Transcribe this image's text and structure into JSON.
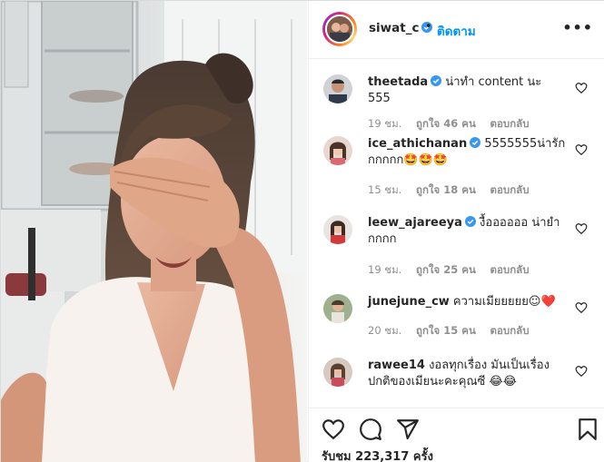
{
  "header": {
    "username": "siwat_c",
    "dot": "•",
    "follow_label": "ติดตาม",
    "more_label": "•••"
  },
  "comments": [
    {
      "username": "theetada",
      "verified": true,
      "text": "น่าทำ content นะ 555",
      "time": "19 ชม.",
      "likes": "ถูกใจ 46 คน",
      "reply": "ตอบกลับ"
    },
    {
      "username": "ice_athichanan",
      "verified": true,
      "text": "5555555น่ารักกกกกก🤩🤩🤩",
      "time": "15 ชม.",
      "likes": "ถูกใจ 18 คน",
      "reply": "ตอบกลับ"
    },
    {
      "username": "leew_ajareeya",
      "verified": true,
      "text": "งื้ออออออ น่ายํากกกก",
      "time": "19 ชม.",
      "likes": "ถูกใจ 25 คน",
      "reply": "ตอบกลับ"
    },
    {
      "username": "junejune_cw",
      "verified": false,
      "text": "ความเมียยยยย☺❤️",
      "time": "20 ชม.",
      "likes": "ถูกใจ 15 คน",
      "reply": "ตอบกลับ"
    },
    {
      "username": "rawee14",
      "verified": false,
      "text": "งอลทุกเรื่อง มันเป็นเรื่องปกติของเมียนะคะคุณซี 😂😂",
      "time": "",
      "likes": "",
      "reply": ""
    }
  ],
  "actions": {
    "views": "รับชม 223,317 ครั้ง"
  },
  "icons": {
    "verified": "verified-badge-icon",
    "heart": "heart-outline-icon",
    "comment": "comment-bubble-icon",
    "share": "paper-plane-icon",
    "save": "bookmark-icon",
    "more": "more-options-icon"
  },
  "colors": {
    "follow": "#0095f6",
    "verified": "#3897f0",
    "text": "#262626",
    "muted": "#8e8e8e",
    "border": "#efefef"
  }
}
